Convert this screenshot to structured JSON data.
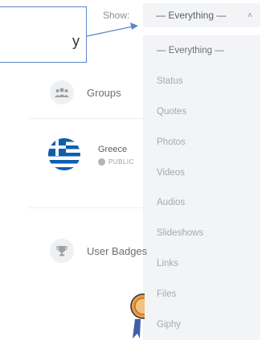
{
  "filter": {
    "show_label": "Show:",
    "selected": "— Everything —",
    "options": [
      "— Everything —",
      "Status",
      "Quotes",
      "Photos",
      "Videos",
      "Audios",
      "Slideshows",
      "Links",
      "Files",
      "Giphy"
    ]
  },
  "annotation": {
    "tail_char": "y"
  },
  "sidebar": {
    "groups_label": "Groups",
    "group": {
      "name": "Greece",
      "privacy": "PUBLIC"
    },
    "badges_label": "User Badges"
  },
  "colors": {
    "accent_arrow": "#5b88c9",
    "dropdown_bg": "#f3f4f6",
    "greece_blue": "#0d5eaf"
  }
}
